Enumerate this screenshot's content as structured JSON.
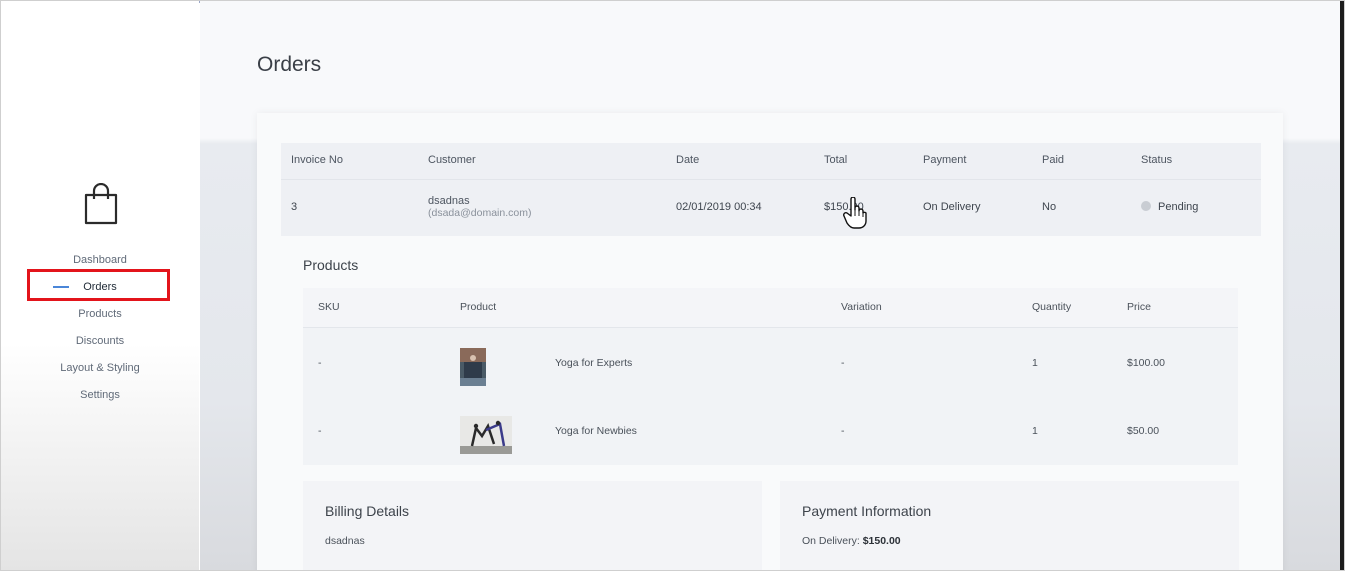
{
  "sidebar": {
    "logo_icon": "shopping-bag-icon",
    "items": [
      {
        "label": "Dashboard"
      },
      {
        "label": "Orders"
      },
      {
        "label": "Products"
      },
      {
        "label": "Discounts"
      },
      {
        "label": "Layout & Styling"
      },
      {
        "label": "Settings"
      }
    ],
    "active_item": "Orders",
    "highlight_color": "#e3141b",
    "accent_color": "#4a86d8"
  },
  "page": {
    "title": "Orders"
  },
  "orders_table": {
    "columns": [
      "Invoice No",
      "Customer",
      "Date",
      "Total",
      "Payment",
      "Paid",
      "Status"
    ],
    "rows": [
      {
        "invoice_no": "3",
        "customer_name": "dsadnas",
        "customer_email": "(dsada@domain.com)",
        "date": "02/01/2019 00:34",
        "total": "$150.00",
        "payment": "On Delivery",
        "paid": "No",
        "status": "Pending"
      }
    ]
  },
  "products": {
    "title": "Products",
    "columns": [
      "SKU",
      "Product",
      "Variation",
      "Quantity",
      "Price"
    ],
    "rows": [
      {
        "sku": "-",
        "product": "Yoga for Experts",
        "variation": "-",
        "quantity": "1",
        "price": "$100.00"
      },
      {
        "sku": "-",
        "product": "Yoga for Newbies",
        "variation": "-",
        "quantity": "1",
        "price": "$50.00"
      }
    ]
  },
  "billing": {
    "title": "Billing Details",
    "name": "dsadnas"
  },
  "payment_info": {
    "title": "Payment Information",
    "method_label": "On Delivery:",
    "amount": "$150.00"
  }
}
